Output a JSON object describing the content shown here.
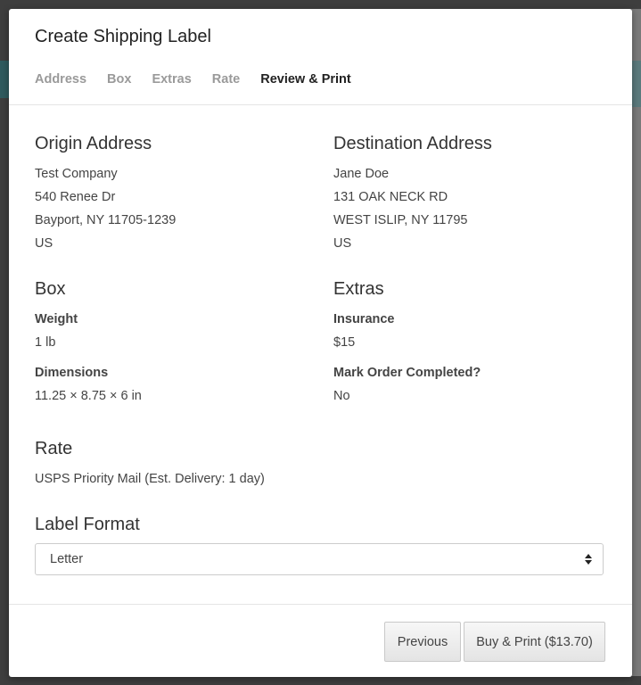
{
  "modal": {
    "title": "Create Shipping Label",
    "steps": [
      {
        "label": "Address",
        "active": false
      },
      {
        "label": "Box",
        "active": false
      },
      {
        "label": "Extras",
        "active": false
      },
      {
        "label": "Rate",
        "active": false
      },
      {
        "label": "Review & Print",
        "active": true
      }
    ]
  },
  "origin": {
    "heading": "Origin Address",
    "lines": [
      "Test Company",
      "540 Renee Dr",
      "Bayport, NY 11705-1239",
      "US"
    ]
  },
  "destination": {
    "heading": "Destination Address",
    "lines": [
      "Jane Doe",
      "131 OAK NECK RD",
      "WEST ISLIP, NY 11795",
      "US"
    ]
  },
  "box": {
    "heading": "Box",
    "weight_label": "Weight",
    "weight_value": "1 lb",
    "dimensions_label": "Dimensions",
    "dimensions_value": "11.25 × 8.75 × 6 in"
  },
  "extras": {
    "heading": "Extras",
    "insurance_label": "Insurance",
    "insurance_value": "$15",
    "mark_completed_label": "Mark Order Completed?",
    "mark_completed_value": "No"
  },
  "rate": {
    "heading": "Rate",
    "value": "USPS Priority Mail (Est. Delivery: 1 day)"
  },
  "label_format": {
    "heading": "Label Format",
    "selected": "Letter"
  },
  "footer": {
    "previous_label": "Previous",
    "buy_label": "Buy & Print ($13.70)"
  },
  "colors": {
    "active_step": "#222222",
    "inactive_step": "#9a9a9a",
    "backdrop": "#3e3e3e"
  }
}
